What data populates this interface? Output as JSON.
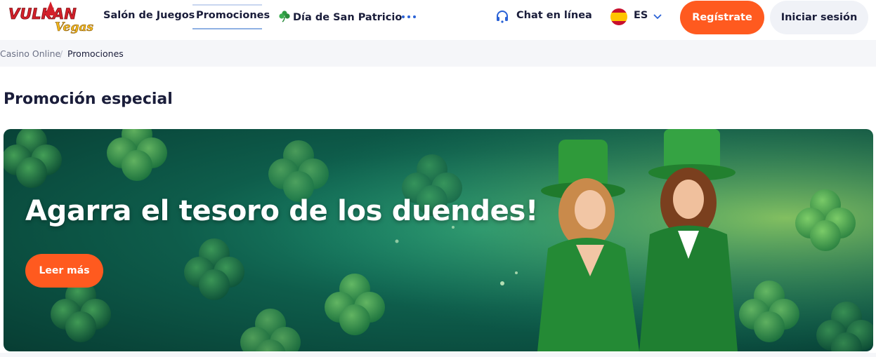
{
  "header": {
    "logo_text": "VULKAN Vegas",
    "nav": [
      {
        "label": "Salón de Juegos"
      },
      {
        "label": "Promociones"
      },
      {
        "label": "Día de San Patricio"
      }
    ],
    "chat_label": "Chat en línea",
    "language": "ES",
    "register_label": "Regístrate",
    "login_label": "Iniciar sesión"
  },
  "breadcrumb": {
    "home": "Casino Online",
    "separator": "/",
    "current": "Promociones"
  },
  "page": {
    "title": "Promoción especial"
  },
  "banner": {
    "headline": "Agarra el tesoro de los duendes!",
    "cta_label": "Leer más"
  },
  "colors": {
    "accent": "#ff5a1f",
    "text_dark": "#1a1d3a",
    "link_blue": "#2a62d6",
    "banner_green": "#0e5d4b"
  }
}
